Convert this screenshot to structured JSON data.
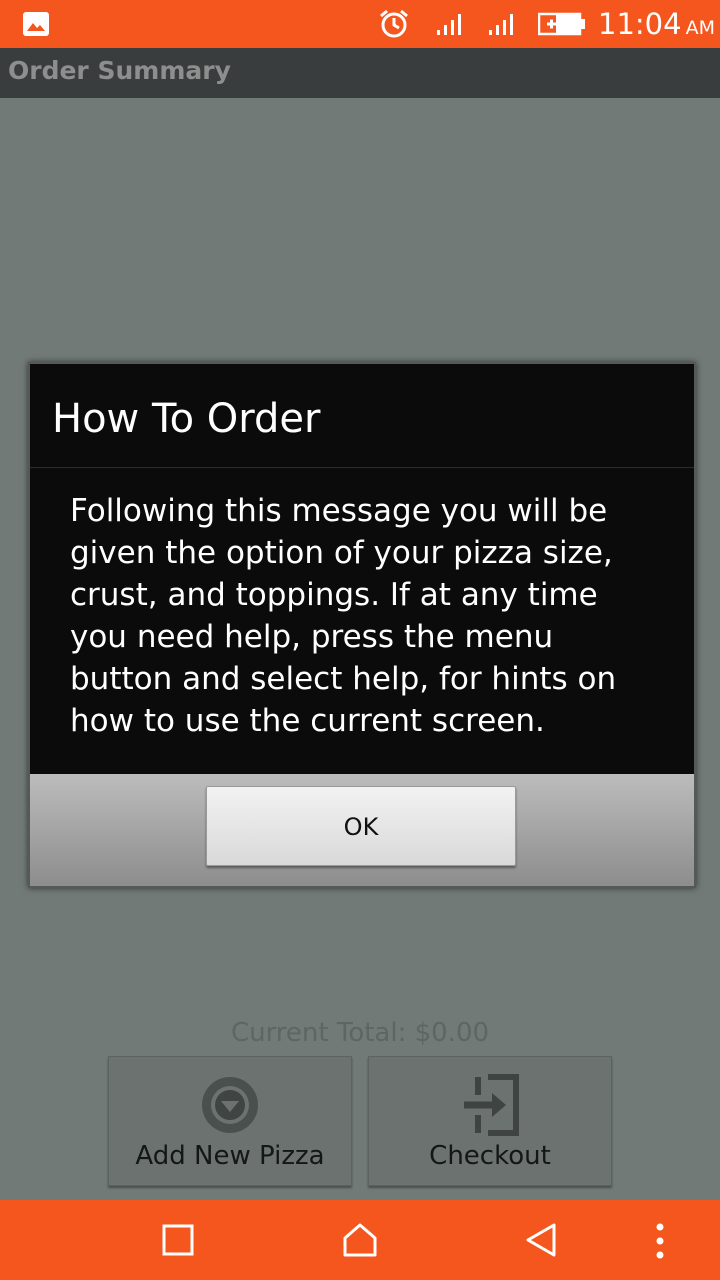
{
  "status_bar": {
    "time": "11:04",
    "ampm": "AM",
    "icons": [
      "gallery-icon",
      "alarm-icon",
      "signal-icon",
      "signal-icon",
      "battery-icon"
    ]
  },
  "app_bar": {
    "title": "Order Summary"
  },
  "background": {
    "empty_text": "empty",
    "current_total": "Current Total: $0.00",
    "add_pizza_label": "Add New Pizza",
    "checkout_label": "Checkout"
  },
  "dialog": {
    "title": "How To Order",
    "message": "Following this message you will be given the option of your pizza size, crust, and toppings. If at any time you need help, press the menu button and select help, for hints on how to use the current screen.",
    "ok_label": "OK"
  },
  "colors": {
    "accent": "#f4561e",
    "dialog_bg": "#0a0b0a",
    "scrim": "#727a78"
  },
  "nav_bar": {
    "icons": [
      "recents-icon",
      "home-icon",
      "back-icon",
      "menu-icon"
    ]
  }
}
